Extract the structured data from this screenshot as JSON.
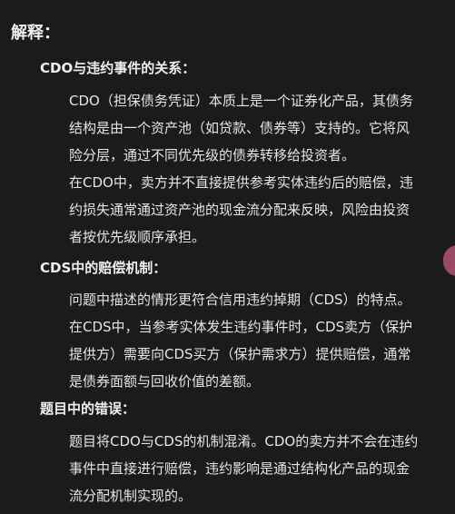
{
  "heading": "解释：",
  "sections": [
    {
      "title": "CDO与违约事件的关系：",
      "paragraphs": [
        {
          "lines": [
            "CDO（担保债务凭证）本质上是一个证券化产品，其债务",
            "结构是由一个资产池（如贷款、债券等）支持的。它将风",
            "险分层，通过不同优先级的债券转移给投资者。"
          ]
        },
        {
          "lines": [
            "在CDO中，卖方并不直接提供参考实体违约后的赔偿，违",
            "约损失通常通过资产池的现金流分配来反映，风险由投资",
            "者按优先级顺序承担。"
          ]
        }
      ]
    },
    {
      "title": "CDS中的赔偿机制：",
      "paragraphs": [
        {
          "lines": [
            "问题中描述的情形更符合信用违约掉期（CDS）的特点。",
            "在CDS中，当参考实体发生违约事件时，CDS卖方（保护",
            "提供方）需要向CDS买方（保护需求方）提供赔偿，通常",
            "是债券面额与回收价值的差额。"
          ]
        }
      ]
    },
    {
      "title": "题目中的错误：",
      "paragraphs": [
        {
          "lines": [
            "题目将CDO与CDS的机制混淆。CDO的卖方并不会在违约",
            "事件中直接进行赔偿，违约影响是通过结构化产品的现金",
            "流分配机制实现的。"
          ]
        }
      ]
    }
  ],
  "colors": {
    "background": "#1b1b1b",
    "text": "#e6e6e6",
    "handle": "#9a4a63"
  }
}
